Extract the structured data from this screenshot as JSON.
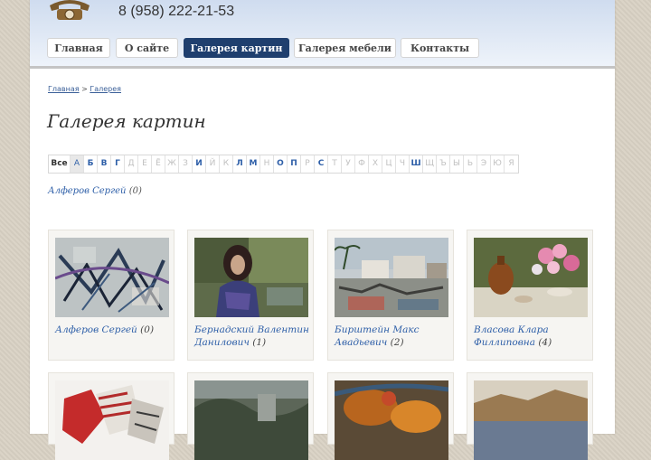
{
  "header": {
    "phone": "8 (958) 222-21-53"
  },
  "nav": [
    {
      "label": "Главная"
    },
    {
      "label": "О сайте"
    },
    {
      "label": "Галерея картин"
    },
    {
      "label": "Галерея мебели"
    },
    {
      "label": "Контакты"
    }
  ],
  "breadcrumb": {
    "home": "Главная",
    "sep": ">",
    "current": "Галерея"
  },
  "page_title": "Галерея картин",
  "alphabet": [
    "Все",
    "А",
    "Б",
    "В",
    "Г",
    "Д",
    "Е",
    "Ё",
    "Ж",
    "З",
    "И",
    "Й",
    "К",
    "Л",
    "М",
    "Н",
    "О",
    "П",
    "Р",
    "С",
    "Т",
    "У",
    "Ф",
    "Х",
    "Ц",
    "Ч",
    "Ш",
    "Щ",
    "Ъ",
    "Ы",
    "Ь",
    "Э",
    "Ю",
    "Я"
  ],
  "alphabet_active": [
    "Все",
    "А",
    "Б",
    "В",
    "Г",
    "И",
    "Л",
    "М",
    "О",
    "П",
    "С",
    "Ш"
  ],
  "alphabet_selected": "А",
  "filter_result": {
    "name": "Алферов Сергей",
    "count": "(0)"
  },
  "cards": [
    {
      "name": "Алферов Сергей",
      "count": "(0)"
    },
    {
      "name": "Бернадский Валентин Данилович",
      "count": "(1)"
    },
    {
      "name": "Бирштейн Макс Авадьевич",
      "count": "(2)"
    },
    {
      "name": "Власова Клара Филлиповна",
      "count": "(4)"
    },
    {
      "name": "",
      "count": ""
    },
    {
      "name": "",
      "count": ""
    },
    {
      "name": "",
      "count": ""
    },
    {
      "name": "",
      "count": ""
    }
  ],
  "colors": {
    "nav_active": "#1f3f6e",
    "link": "#2e5fa8",
    "header_top": "#cfdcef"
  }
}
